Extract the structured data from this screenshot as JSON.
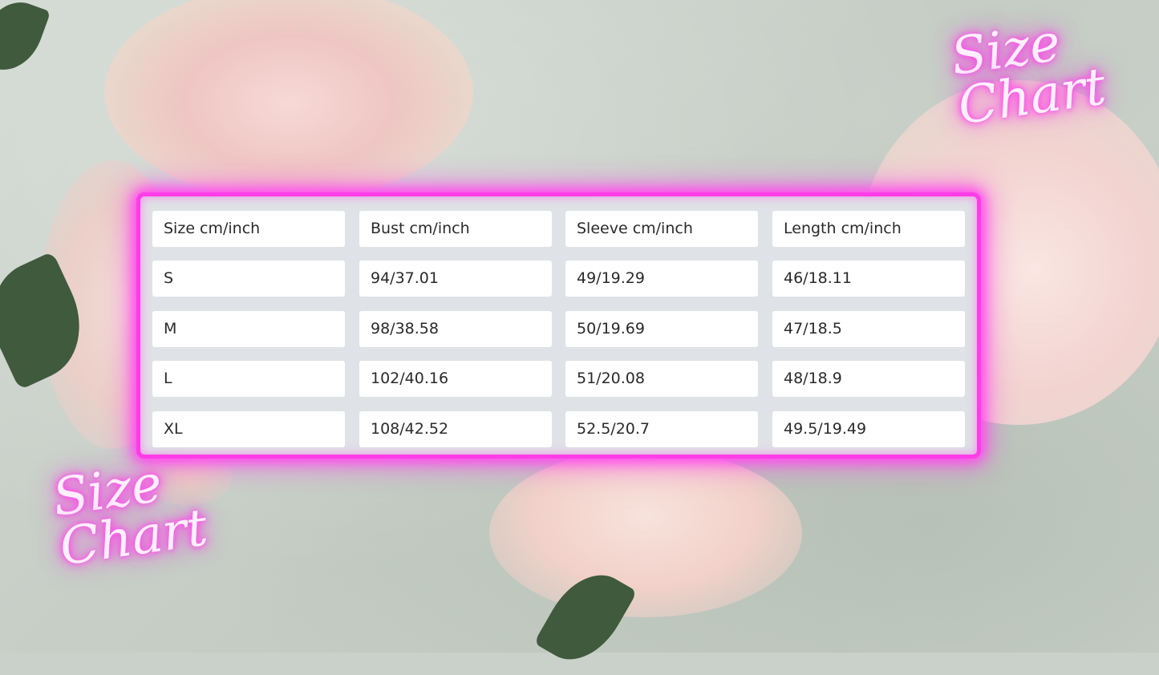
{
  "decor": {
    "top_right_title": [
      "Size",
      "Chart"
    ],
    "bottom_left_title": [
      "Size",
      "Chart"
    ],
    "neon_color": "#ff3de8"
  },
  "size_table": {
    "headers": [
      "Size cm/inch",
      "Bust cm/inch",
      "Sleeve cm/inch",
      "Length cm/inch"
    ],
    "rows": [
      [
        "S",
        "94/37.01",
        "49/19.29",
        "46/18.11"
      ],
      [
        "M",
        "98/38.58",
        "50/19.69",
        "47/18.5"
      ],
      [
        "L",
        "102/40.16",
        "51/20.08",
        "48/18.9"
      ],
      [
        "XL",
        "108/42.52",
        "52.5/20.7",
        "49.5/19.49"
      ]
    ]
  }
}
